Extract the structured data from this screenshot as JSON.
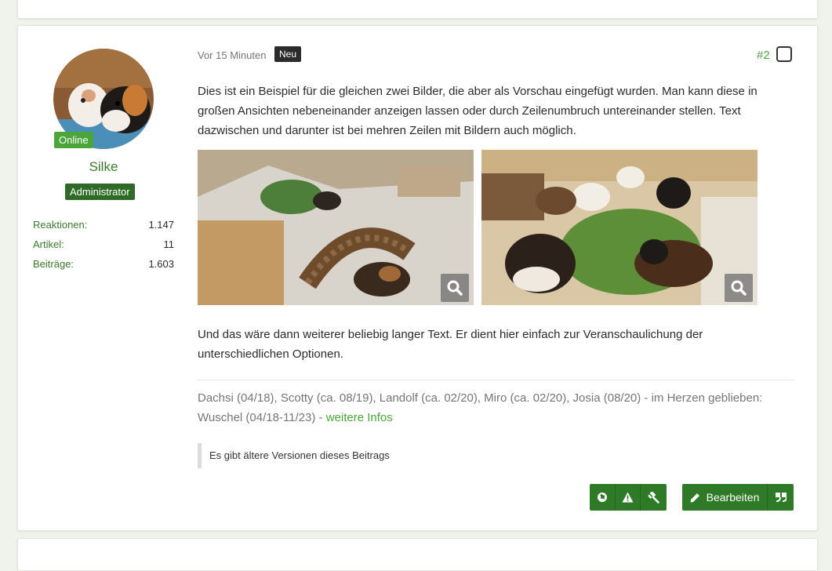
{
  "author": {
    "status": "Online",
    "name": "Silke",
    "role": "Administrator",
    "stats": [
      {
        "label": "Reaktionen:",
        "value": "1.147"
      },
      {
        "label": "Artikel:",
        "value": "11"
      },
      {
        "label": "Beiträge:",
        "value": "1.603"
      }
    ]
  },
  "post": {
    "time": "Vor 15 Minuten",
    "badge": "Neu",
    "number": "#2",
    "paragraph1": "Dies ist ein Beispiel für die gleichen zwei Bilder, die aber als Vorschau eingefügt wurden. Man kann diese in großen Ansichten nebeneinander anzeigen lassen oder durch Zeilenumbruch untereinander stellen. Text dazwischen und darunter ist bei mehren Zeilen mit Bildern auch möglich.",
    "paragraph2": "Und das wäre dann weiterer beliebig langer Text. Er dient hier einfach zur Veranschaulichung der unterschiedlichen Optionen.",
    "signature": "Dachsi (04/18), Scotty (ca. 08/19), Landolf (ca. 02/20), Miro (ca. 02/20), Josia (08/20) - im Herzen geblieben: Wuschel (04/18-11/23) - ",
    "signature_link": "weitere Infos",
    "versions_note": "Es gibt ältere Versionen dieses Beitrags"
  },
  "actions": {
    "edit_label": "Bearbeiten",
    "icons": [
      "globe-icon",
      "warning-icon",
      "gavel-icon",
      "pencil-icon",
      "quote-icon"
    ]
  },
  "colors": {
    "accent": "#4aa63a",
    "dark_green": "#2f7a27",
    "badge_dark": "#2b2b2b"
  }
}
